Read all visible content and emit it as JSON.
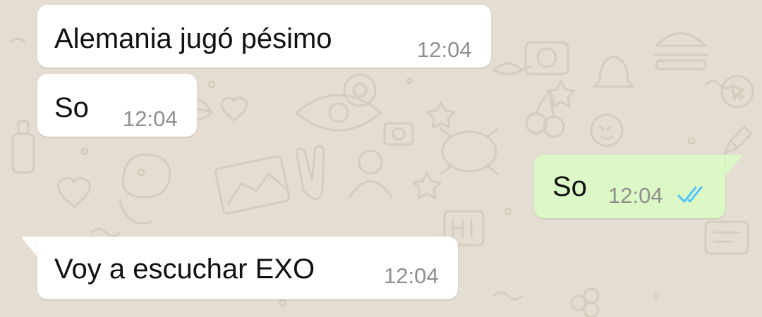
{
  "wallpaper": {
    "color": "#e6ddd2",
    "doodle_color": "#d5cbbd"
  },
  "messages": [
    {
      "direction": "incoming",
      "text": "Alemania jugó pésimo",
      "time": "12:04"
    },
    {
      "direction": "incoming",
      "text": "So",
      "time": "12:04"
    },
    {
      "direction": "outgoing",
      "text": "So",
      "time": "12:04",
      "status": "read",
      "status_icon": "double-check-icon",
      "status_color": "#4fc3f7"
    },
    {
      "direction": "incoming",
      "text": "Voy a escuchar EXO",
      "time": "12:04"
    }
  ],
  "colors": {
    "incoming_bubble": "#ffffff",
    "outgoing_bubble": "#dcf8c6",
    "time_text": "#8f8f8f"
  }
}
